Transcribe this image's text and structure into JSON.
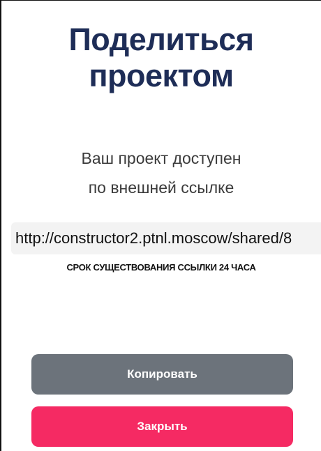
{
  "dialog": {
    "title_line1": "Поделиться",
    "title_line2": "проектом",
    "message_line1": "Ваш проект доступен",
    "message_line2": "по внешней ссылке",
    "share_link": "http://constructor2.ptnl.moscow/shared/8",
    "expiry_note": "СРОК СУЩЕСТВОВАНИЯ ССЫЛКИ 24 ЧАСА",
    "copy_label": "Копировать",
    "close_label": "Закрыть"
  },
  "colors": {
    "title": "#1e2d57",
    "copy_button": "#6c737b",
    "close_button": "#f52a63",
    "link_background": "#f3f3f3"
  }
}
